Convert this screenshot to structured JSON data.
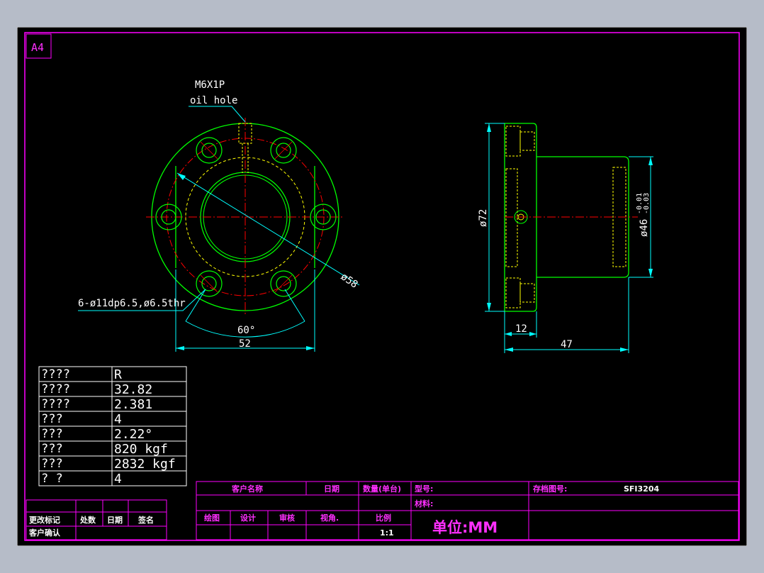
{
  "sheet": {
    "size_tag": "A4",
    "colors": {
      "border": "#ff00ff",
      "outline": "#00ff00",
      "centerline": "#ff0000",
      "hidden": "#ffff00",
      "dimension": "#00ffff",
      "text": "#ffffff"
    }
  },
  "front_view": {
    "thread_note": "M6X1P",
    "oil_hole_note": "oil hole",
    "hole_note": "6-ø11dp6.5,ø6.5thr",
    "diameter_label": "ø58",
    "angle_label": "60°",
    "width_label": "52"
  },
  "side_view": {
    "outer_dia_label": "ø72",
    "body_dia_label": "ø46",
    "tol_upper": "-0.01",
    "tol_lower": "-0.03",
    "flange_width_label": "12",
    "length_label": "47"
  },
  "spec_table": {
    "rows": [
      {
        "name": "????",
        "value": "R"
      },
      {
        "name": "????",
        "value": "32.82"
      },
      {
        "name": "????",
        "value": "2.381"
      },
      {
        "name": " ???",
        "value": " 4"
      },
      {
        "name": " ???",
        "value": " 2.22°"
      },
      {
        "name": " ???",
        "value": " 820 kgf"
      },
      {
        "name": " ???",
        "value": " 2832 kgf"
      },
      {
        "name": " ?  ?",
        "value": " 4"
      }
    ]
  },
  "revision_block": {
    "change_mark": "更改标记",
    "location_count": "处数",
    "date": "日期",
    "signature": "签名",
    "customer_confirm": "客户确认"
  },
  "title_block": {
    "customer_name": "客户名称",
    "date": "日期",
    "quantity": "数量(单台)",
    "model": "型号:",
    "archive_no": "存档图号:",
    "archive_value": "SFI3204",
    "material": "材料:",
    "drawn": "绘图",
    "designed": "设计",
    "reviewed": "审核",
    "view_angle": "视角.",
    "scale": "比例",
    "scale_value": "1:1",
    "unit": "单位:MM"
  }
}
